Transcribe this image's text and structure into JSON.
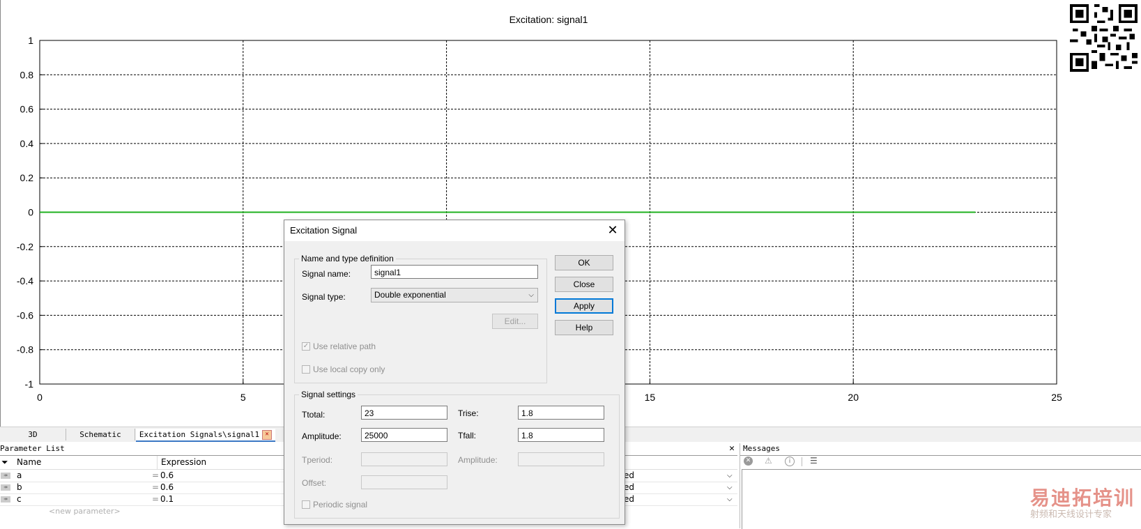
{
  "chart_data": {
    "type": "line",
    "title": "Excitation: signal1",
    "xlabel": "",
    "ylabel": "",
    "xlim": [
      0,
      25
    ],
    "ylim": [
      -1,
      1
    ],
    "xticks": [
      "0",
      "5",
      "10",
      "15",
      "20",
      "25"
    ],
    "yticks": [
      "1",
      "0.8",
      "0.6",
      "0.4",
      "0.2",
      "0",
      "-0.2",
      "-0.4",
      "-0.6",
      "-0.8",
      "-1"
    ],
    "grid": true,
    "series": [
      {
        "x": [
          0,
          23
        ],
        "y": [
          0,
          0
        ],
        "color": "#1fb01f"
      }
    ]
  },
  "tabs": [
    {
      "label": "3D",
      "active": false
    },
    {
      "label": "Schematic",
      "active": false
    },
    {
      "label": "Excitation Signals\\signal1",
      "active": true
    }
  ],
  "param_panel": {
    "title": "Parameter List",
    "col_name": "Name",
    "col_expr": "Expression",
    "rows": [
      {
        "name": "a",
        "eq": "=",
        "expr": "0.6",
        "tail": "ed"
      },
      {
        "name": "b",
        "eq": "=",
        "expr": "0.6",
        "tail": "ed"
      },
      {
        "name": "c",
        "eq": "=",
        "expr": "0.1",
        "tail": "ed"
      }
    ],
    "new_param": "<new parameter>"
  },
  "messages": {
    "title": "Messages"
  },
  "dialog": {
    "title": "Excitation Signal",
    "group1": "Name and type definition",
    "signal_name_label": "Signal name:",
    "signal_name_value": "signal1",
    "signal_type_label": "Signal type:",
    "signal_type_value": "Double exponential",
    "edit_button": "Edit...",
    "use_relative_path": "Use relative path",
    "use_local_copy": "Use local copy only",
    "group2": "Signal settings",
    "ttotal_label": "Ttotal:",
    "ttotal_value": "23",
    "trise_label": "Trise:",
    "trise_value": "1.8",
    "amplitude_label": "Amplitude:",
    "amplitude_value": "25000",
    "tfall_label": "Tfall:",
    "tfall_value": "1.8",
    "tperiod_label": "Tperiod:",
    "amplitude2_label": "Amplitude:",
    "offset_label": "Offset:",
    "periodic_label": "Periodic signal",
    "ok": "OK",
    "close": "Close",
    "apply": "Apply",
    "help": "Help"
  },
  "watermark": {
    "line1": "易迪拓培训",
    "line2": "射频和天线设计专家"
  }
}
